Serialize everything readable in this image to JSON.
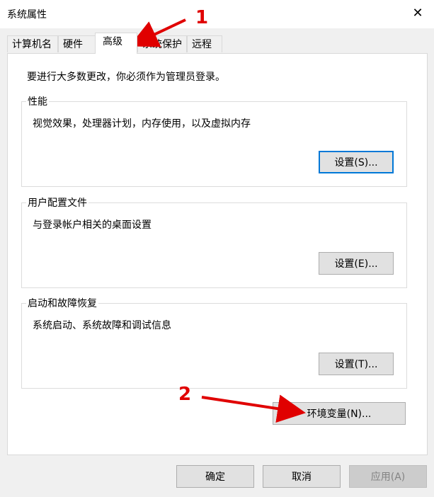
{
  "window": {
    "title": "系统属性",
    "close_glyph": "✕"
  },
  "tabs": [
    {
      "label": "计算机名"
    },
    {
      "label": "硬件"
    },
    {
      "label": "高级",
      "active": true
    },
    {
      "label": "系统保护"
    },
    {
      "label": "远程"
    }
  ],
  "intro": "要进行大多数更改，你必须作为管理员登录。",
  "groups": {
    "performance": {
      "title": "性能",
      "desc": "视觉效果，处理器计划，内存使用，以及虚拟内存",
      "button": "设置(S)..."
    },
    "profiles": {
      "title": "用户配置文件",
      "desc": "与登录帐户相关的桌面设置",
      "button": "设置(E)..."
    },
    "startup": {
      "title": "启动和故障恢复",
      "desc": "系统启动、系统故障和调试信息",
      "button": "设置(T)..."
    }
  },
  "env_button": "环境变量(N)...",
  "footer": {
    "ok": "确定",
    "cancel": "取消",
    "apply": "应用(A)"
  },
  "annotations": [
    {
      "label": "1",
      "color": "#e00000"
    },
    {
      "label": "2",
      "color": "#e00000"
    }
  ],
  "icons": {
    "close": "close-icon"
  }
}
